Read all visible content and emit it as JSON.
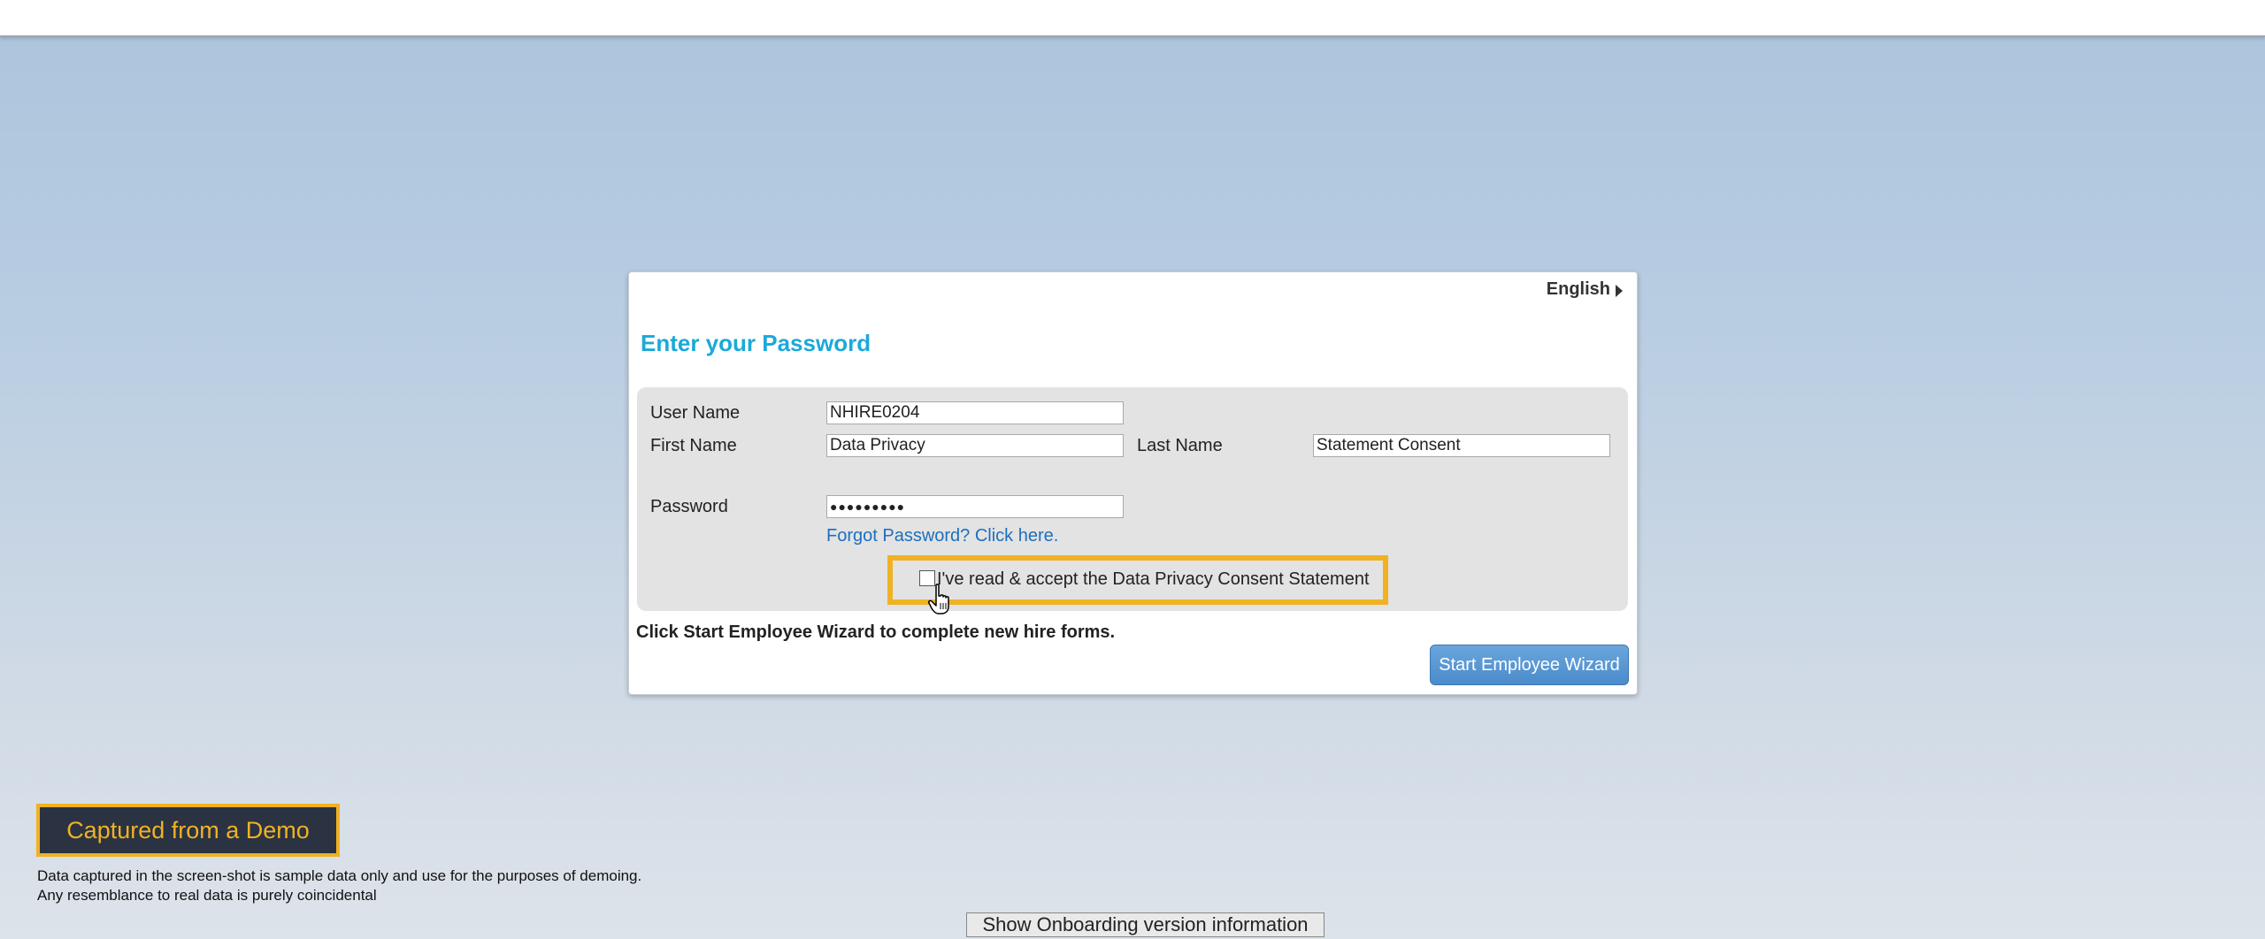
{
  "language": {
    "label": "English"
  },
  "card": {
    "title": "Enter your Password"
  },
  "form": {
    "username_label": "User Name",
    "username_value": "NHIRE0204",
    "firstname_label": "First Name",
    "firstname_value": "Data Privacy",
    "lastname_label": "Last Name",
    "lastname_value": "Statement Consent",
    "password_label": "Password",
    "password_value": "●●●●●●●●●",
    "forgot_link": "Forgot Password? Click here.",
    "consent_text": "I've read & accept the Data Privacy Consent Statement",
    "consent_checked": false
  },
  "instruction": "Click Start Employee Wizard to complete new hire forms.",
  "start_button": "Start Employee Wizard",
  "demo": {
    "badge": "Captured from a Demo",
    "disclaimer_line1": "Data captured in the screen-shot is sample data only and use for the purposes of demoing.",
    "disclaimer_line2": "Any resemblance to real data is purely coincidental"
  },
  "version_button": "Show Onboarding version information",
  "colors": {
    "title": "#1ba9d9",
    "link": "#1d6fbf",
    "highlight": "#f0b223",
    "button": "#4b8bcb",
    "badge_bg": "#2b3342"
  },
  "icons": {
    "language_arrow": "caret-right-icon",
    "cursor": "hand-pointer-icon"
  }
}
